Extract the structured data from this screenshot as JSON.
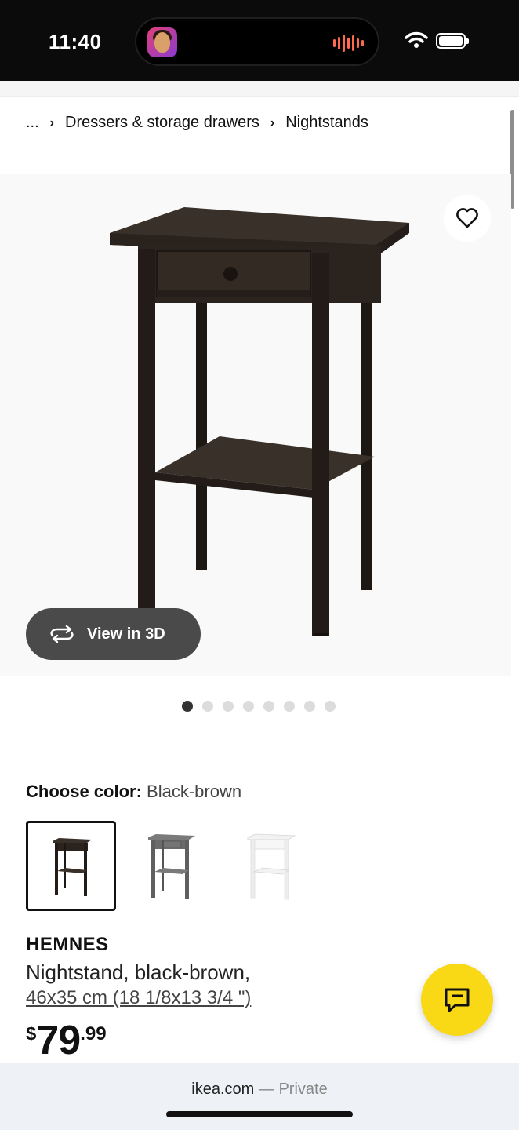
{
  "status_bar": {
    "time": "11:40"
  },
  "breadcrumb": {
    "ellipsis": "...",
    "items": [
      "Dressers & storage drawers",
      "Nightstands"
    ]
  },
  "gallery": {
    "view_3d_label": "View in 3D",
    "image_count": 8,
    "active_index": 0
  },
  "color_chooser": {
    "label": "Choose color:",
    "selected_value": "Black-brown",
    "options": [
      {
        "color": "#2e2520",
        "selected": true
      },
      {
        "color": "#6b6b6b",
        "selected": false
      },
      {
        "color": "#f4f4f4",
        "selected": false
      }
    ]
  },
  "product": {
    "name": "HEMNES",
    "description": "Nightstand, black-brown,",
    "size": "46x35 cm (18 1/8x13 3/4 \")",
    "price": {
      "currency": "$",
      "dollars": "79",
      "cents": ".99"
    }
  },
  "browser": {
    "domain": "ikea.com",
    "mode": "— Private"
  },
  "colors": {
    "accent_yellow": "#f9d816",
    "furniture": "#2e2520"
  },
  "icons": {
    "favorite": "heart-icon",
    "view3d": "rotate-icon",
    "chat": "chat-icon"
  }
}
